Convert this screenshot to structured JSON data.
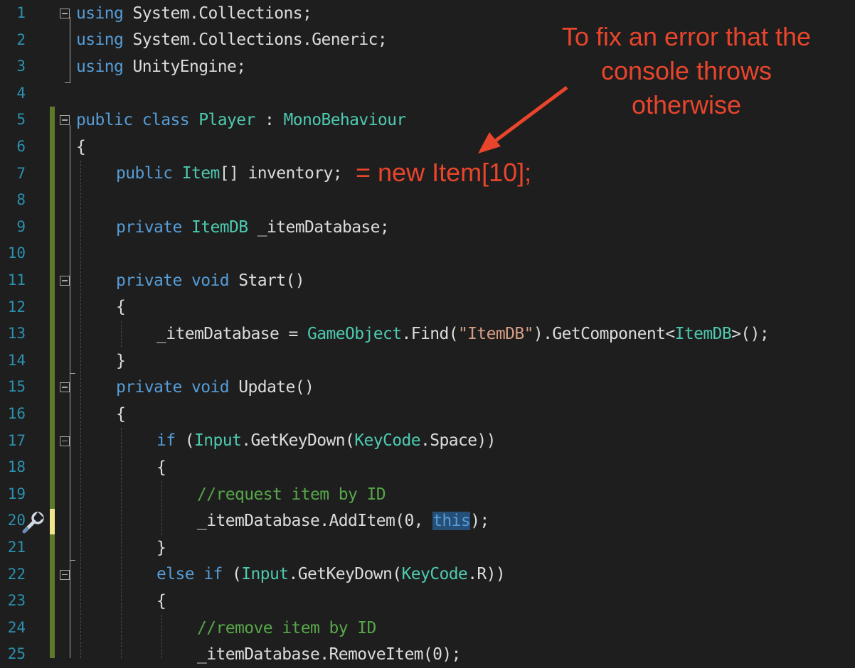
{
  "colors": {
    "background": "#1e1e1e",
    "keyword": "#569cd6",
    "type": "#4ec9b0",
    "comment": "#57a64a",
    "string": "#d69d85",
    "line_number": "#2b91af",
    "annotation": "#e8452c",
    "selection": "#264f78"
  },
  "annotation": {
    "callout_line1": "To fix an error that the",
    "callout_line2": "console throws",
    "callout_line3": "otherwise",
    "inline_text": "= new Item[10];"
  },
  "icons": {
    "quick_action": "wrench-icon",
    "arrow": "arrow-icon"
  },
  "lines": [
    {
      "n": "1",
      "tokens": [
        [
          "kw",
          "using"
        ],
        [
          "pl",
          " System.Collections;"
        ]
      ]
    },
    {
      "n": "2",
      "tokens": [
        [
          "kw",
          "using"
        ],
        [
          "pl",
          " System.Collections.Generic;"
        ]
      ]
    },
    {
      "n": "3",
      "tokens": [
        [
          "kw",
          "using"
        ],
        [
          "pl",
          " UnityEngine;"
        ]
      ]
    },
    {
      "n": "4",
      "tokens": []
    },
    {
      "n": "5",
      "tokens": [
        [
          "kw",
          "public class "
        ],
        [
          "ty",
          "Player"
        ],
        [
          "pl",
          " : "
        ],
        [
          "ty",
          "MonoBehaviour"
        ]
      ]
    },
    {
      "n": "6",
      "tokens": [
        [
          "pl",
          "{"
        ]
      ]
    },
    {
      "n": "7",
      "tokens": [
        [
          "kw",
          "public "
        ],
        [
          "ty",
          "Item"
        ],
        [
          "pl",
          "[] inventory;"
        ]
      ]
    },
    {
      "n": "8",
      "tokens": []
    },
    {
      "n": "9",
      "tokens": [
        [
          "kw",
          "private "
        ],
        [
          "ty",
          "ItemDB"
        ],
        [
          "pl",
          " _itemDatabase;"
        ]
      ]
    },
    {
      "n": "10",
      "tokens": []
    },
    {
      "n": "11",
      "tokens": [
        [
          "kw",
          "private void "
        ],
        [
          "pl",
          "Start()"
        ]
      ]
    },
    {
      "n": "12",
      "tokens": [
        [
          "pl",
          "{"
        ]
      ]
    },
    {
      "n": "13",
      "tokens": [
        [
          "pl",
          "_itemDatabase = "
        ],
        [
          "ty",
          "GameObject"
        ],
        [
          "pl",
          ".Find("
        ],
        [
          "st",
          "\"ItemDB\""
        ],
        [
          "pl",
          ").GetComponent<"
        ],
        [
          "ty",
          "ItemDB"
        ],
        [
          "pl",
          ">();"
        ]
      ]
    },
    {
      "n": "14",
      "tokens": [
        [
          "pl",
          "}"
        ]
      ]
    },
    {
      "n": "15",
      "tokens": [
        [
          "kw",
          "private void "
        ],
        [
          "pl",
          "Update()"
        ]
      ]
    },
    {
      "n": "16",
      "tokens": [
        [
          "pl",
          "{"
        ]
      ]
    },
    {
      "n": "17",
      "tokens": [
        [
          "kw",
          "if"
        ],
        [
          "pl",
          " ("
        ],
        [
          "ty",
          "Input"
        ],
        [
          "pl",
          ".GetKeyDown("
        ],
        [
          "ty",
          "KeyCode"
        ],
        [
          "pl",
          ".Space))"
        ]
      ]
    },
    {
      "n": "18",
      "tokens": [
        [
          "pl",
          "{"
        ]
      ]
    },
    {
      "n": "19",
      "tokens": [
        [
          "cm",
          "//request item by ID"
        ]
      ]
    },
    {
      "n": "20",
      "tokens": [
        [
          "pl",
          "_itemDatabase.AddItem(0, "
        ],
        [
          "sel",
          "this"
        ],
        [
          "pl",
          ");"
        ]
      ]
    },
    {
      "n": "21",
      "tokens": [
        [
          "pl",
          "}"
        ]
      ]
    },
    {
      "n": "22",
      "tokens": [
        [
          "kw",
          "else if"
        ],
        [
          "pl",
          " ("
        ],
        [
          "ty",
          "Input"
        ],
        [
          "pl",
          ".GetKeyDown("
        ],
        [
          "ty",
          "KeyCode"
        ],
        [
          "pl",
          ".R))"
        ]
      ]
    },
    {
      "n": "23",
      "tokens": [
        [
          "pl",
          "{"
        ]
      ]
    },
    {
      "n": "24",
      "tokens": [
        [
          "cm",
          "//remove item by ID"
        ]
      ]
    },
    {
      "n": "25",
      "tokens": [
        [
          "pl",
          "_itemDatabase.RemoveItem(0);"
        ]
      ]
    }
  ]
}
